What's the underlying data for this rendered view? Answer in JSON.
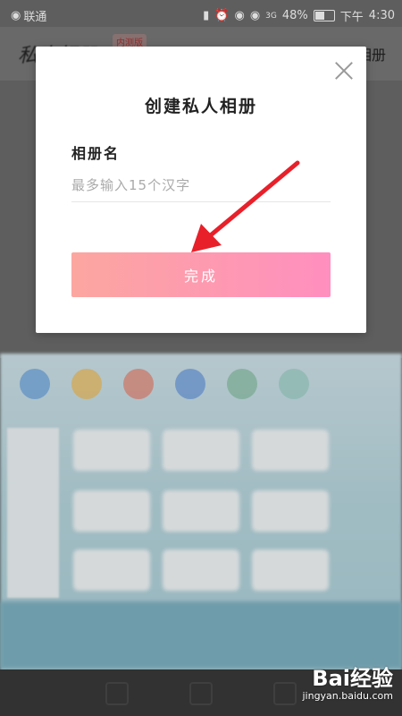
{
  "status_bar": {
    "carrier": "联通",
    "battery": "48%",
    "period": "下午",
    "time": "4:30",
    "network": "3G"
  },
  "background": {
    "title": "私人相册",
    "badge": "内测版",
    "right_label": "公共相册"
  },
  "dialog": {
    "title": "创建私人相册",
    "field_label": "相册名",
    "input": {
      "value": "",
      "placeholder": "最多输入15个汉字"
    },
    "error_text": "",
    "submit_label": "完成",
    "close_icon": "close-icon"
  },
  "colors": {
    "button_gradient_start": "#fca6a0",
    "button_gradient_end": "#ff8fbf",
    "annotation_arrow": "#e8202a"
  },
  "watermark": {
    "brand": "Bai经验",
    "url": "jingyan.baidu.com"
  }
}
